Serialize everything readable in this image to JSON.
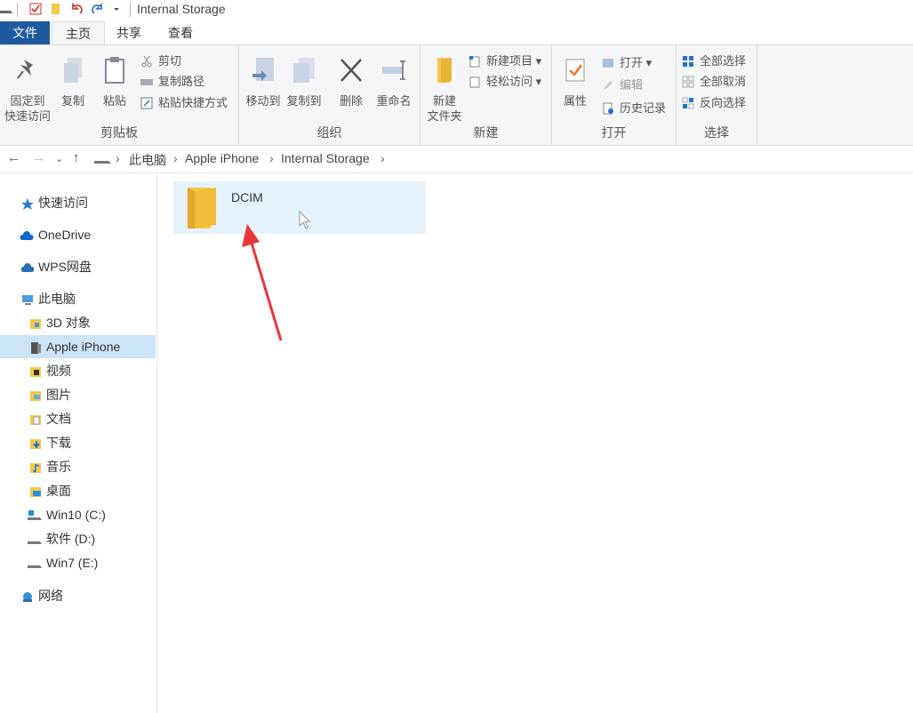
{
  "window": {
    "title": "Internal Storage"
  },
  "menu": {
    "tabs": [
      {
        "label": "文件"
      },
      {
        "label": "主页"
      },
      {
        "label": "共享"
      },
      {
        "label": "查看"
      }
    ]
  },
  "ribbon": {
    "clipboard": {
      "label": "剪贴板",
      "pin": "固定到\n快速访问",
      "copy": "复制",
      "paste": "粘贴",
      "cut": "剪切",
      "copy_path": "复制路径",
      "paste_shortcut": "粘贴快捷方式"
    },
    "organize": {
      "label": "组织",
      "move_to": "移动到",
      "copy_to": "复制到",
      "delete": "删除",
      "rename": "重命名"
    },
    "new": {
      "label": "新建",
      "new_folder": "新建\n文件夹",
      "new_item": "新建项目",
      "easy_access": "轻松访问"
    },
    "open": {
      "label": "打开",
      "properties": "属性",
      "open": "打开",
      "edit": "编辑",
      "history": "历史记录"
    },
    "select": {
      "label": "选择",
      "select_all": "全部选择",
      "select_none": "全部取消",
      "invert": "反向选择"
    }
  },
  "address": {
    "crumbs": [
      "此电脑",
      "Apple iPhone",
      "Internal Storage"
    ]
  },
  "sidebar": {
    "items": [
      {
        "label": "快速访问",
        "icon": "star-icon"
      },
      {
        "label": "OneDrive",
        "icon": "cloud-icon"
      },
      {
        "label": "WPS网盘",
        "icon": "cloud-icon"
      },
      {
        "label": "此电脑",
        "icon": "computer-icon"
      },
      {
        "label": "3D 对象",
        "icon": "folder-icon"
      },
      {
        "label": "Apple iPhone",
        "icon": "phone-icon"
      },
      {
        "label": "视频",
        "icon": "video-folder-icon"
      },
      {
        "label": "图片",
        "icon": "pictures-folder-icon"
      },
      {
        "label": "文档",
        "icon": "documents-folder-icon"
      },
      {
        "label": "下载",
        "icon": "downloads-folder-icon"
      },
      {
        "label": "音乐",
        "icon": "music-folder-icon"
      },
      {
        "label": "桌面",
        "icon": "desktop-folder-icon"
      },
      {
        "label": "Win10 (C:)",
        "icon": "drive-icon"
      },
      {
        "label": "软件 (D:)",
        "icon": "drive-icon"
      },
      {
        "label": "Win7 (E:)",
        "icon": "drive-icon"
      },
      {
        "label": "网络",
        "icon": "network-icon"
      }
    ]
  },
  "content": {
    "items": [
      {
        "name": "DCIM",
        "icon": "folder-icon"
      }
    ]
  },
  "colors": {
    "accent": "#1f5a9e",
    "selection": "#cce4f7",
    "hover": "#e5f1fb",
    "folder": "#f5c84c",
    "annotation_arrow": "#e8363a"
  }
}
